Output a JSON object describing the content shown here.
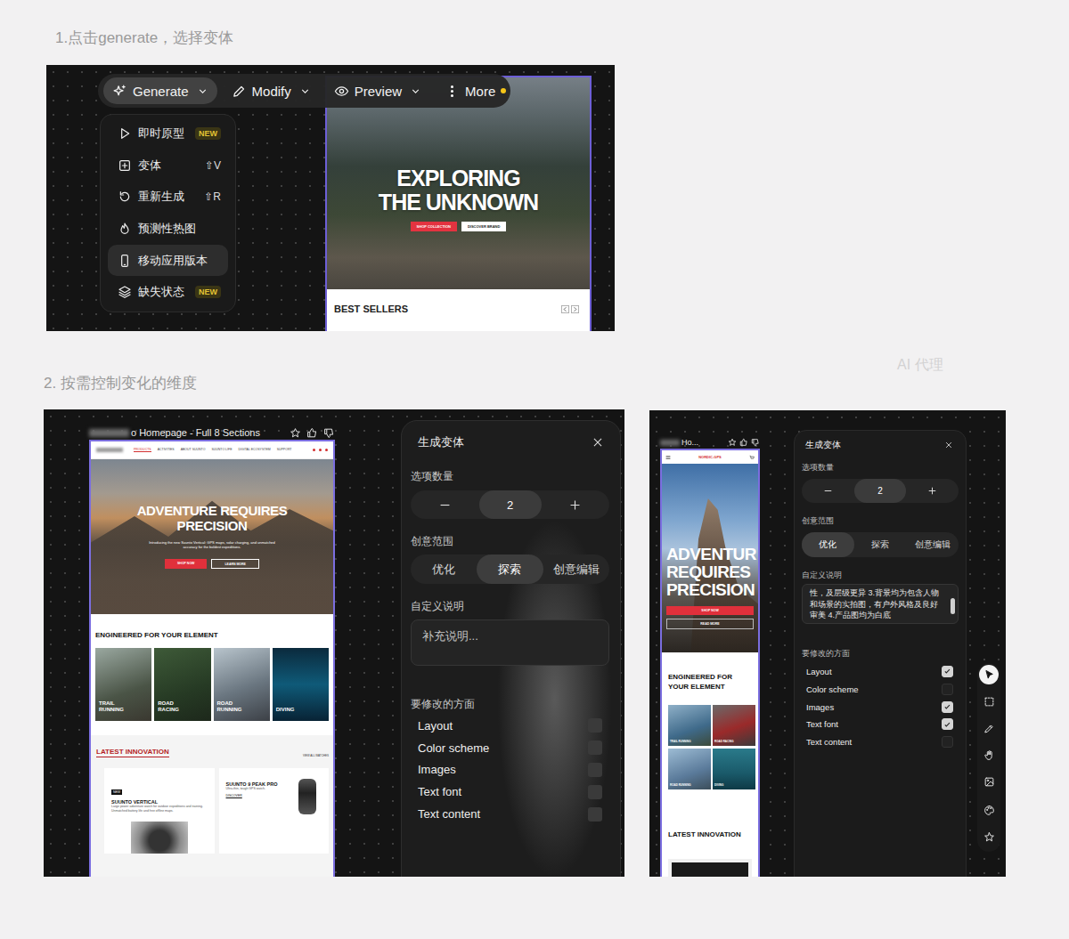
{
  "captions": {
    "step1": "1.点击generate，选择变体",
    "step2": "2. 按需控制变化的维度",
    "agent": "AI 代理"
  },
  "toolbar": [
    {
      "kind": "sparkle",
      "label": "Generate",
      "selected": true,
      "caret": true,
      "dot": false
    },
    {
      "kind": "pencil",
      "label": "Modify",
      "selected": false,
      "caret": true,
      "dot": false
    },
    {
      "kind": "eye",
      "label": "Preview",
      "selected": false,
      "caret": true,
      "dot": false
    },
    {
      "kind": "dots",
      "label": "More",
      "selected": false,
      "caret": false,
      "dot": true
    }
  ],
  "menu": [
    {
      "kind": "play",
      "label": "即时原型",
      "shortcut": "",
      "badge": "NEW",
      "selected": false
    },
    {
      "kind": "plus-square",
      "label": "变体",
      "shortcut": "⇧V",
      "badge": "",
      "selected": false
    },
    {
      "kind": "refresh",
      "label": "重新生成",
      "shortcut": "⇧R",
      "badge": "",
      "selected": false
    },
    {
      "kind": "flame",
      "label": "预测性热图",
      "shortcut": "",
      "badge": "",
      "selected": false
    },
    {
      "kind": "phone",
      "label": "移动应用版本",
      "shortcut": "",
      "badge": "",
      "selected": true
    },
    {
      "kind": "layers",
      "label": "缺失状态",
      "shortcut": "",
      "badge": "NEW",
      "selected": false
    }
  ],
  "site1": {
    "headline": [
      "EXPLORING",
      "THE UNKNOWN"
    ],
    "buttons": [
      {
        "label": "SHOP COLLECTION",
        "primary": true
      },
      {
        "label": "DISCOVER BRAND",
        "primary": false
      }
    ],
    "section": "BEST SELLERS"
  },
  "desktop": {
    "frame_title": "o Homepage - Full 8 Sections",
    "nav": [
      {
        "label": "PRODUCTS",
        "selected": true
      },
      {
        "label": "ACTIVITIES",
        "selected": false
      },
      {
        "label": "ABOUT SUUNTO",
        "selected": false
      },
      {
        "label": "SUUNTO LIFE",
        "selected": false
      },
      {
        "label": "DIGITAL ECOSYSTEM",
        "selected": false
      },
      {
        "label": "SUPPORT",
        "selected": false
      }
    ],
    "headline": [
      "ADVENTURE REQUIRES",
      "PRECISION"
    ],
    "subtitle": "Introducing the new Suunto Vertical: GPS maps, solar charging, and unmatched accuracy for the boldest expeditions.",
    "buttons": [
      {
        "label": "SHOP NOW",
        "primary": true
      },
      {
        "label": "LEARN MORE",
        "primary": false
      }
    ],
    "section": "ENGINEERED FOR YOUR ELEMENT",
    "cards": [
      "TRAIL RUNNING",
      "ROAD RACING",
      "ROAD RUNNING",
      "DIVING"
    ],
    "latest": "LATEST INNOVATION",
    "latest_link": "VIEW ALL WATCHES",
    "products": [
      {
        "badge": "NEW",
        "name": "SUUNTO VERTICAL",
        "text": "Large power adventure watch for outdoor expeditions and training. Unmatched battery life and free offline maps.",
        "link": ""
      },
      {
        "badge": "",
        "name": "SUUNTO 9 PEAK PRO",
        "text": "Ultra-thin, tough GPS watch.",
        "link": "DISCOVER"
      }
    ],
    "dialog": {
      "title": "生成变体",
      "count_label": "选项数量",
      "count": "2",
      "scope_label": "创意范围",
      "scopes": [
        {
          "label": "优化",
          "selected": false
        },
        {
          "label": "探索",
          "selected": true
        },
        {
          "label": "创意编辑",
          "selected": false
        }
      ],
      "notes_label": "自定义说明",
      "notes_text": "补充说明...",
      "notes_is_placeholder": true,
      "aspects_label": "要修改的方面",
      "aspects": [
        {
          "label": "Layout",
          "checked": false
        },
        {
          "label": "Color scheme",
          "checked": false
        },
        {
          "label": "Images",
          "checked": false
        },
        {
          "label": "Text font",
          "checked": false
        },
        {
          "label": "Text content",
          "checked": false
        }
      ]
    }
  },
  "mobile": {
    "frame_title": "Ho...",
    "logo": "NORDIC-GPS",
    "headline": [
      "ADVENTUR",
      "REQUIRES",
      "PRECISION"
    ],
    "buttons": [
      {
        "label": "SHOP NOW",
        "primary": true
      },
      {
        "label": "READ MORE",
        "primary": false
      }
    ],
    "section": "ENGINEERED FOR YOUR ELEMENT",
    "tiles": [
      "TRAIL RUNNING",
      "ROAD RACING",
      "ROAD RUNNING",
      "DIVING"
    ],
    "latest": "LATEST INNOVATION",
    "dialog": {
      "title": "生成变体",
      "count_label": "选项数量",
      "count": "2",
      "scope_label": "创意范围",
      "scopes": [
        {
          "label": "优化",
          "selected": true
        },
        {
          "label": "探索",
          "selected": false
        },
        {
          "label": "创意编辑",
          "selected": false
        }
      ],
      "notes_label": "自定义说明",
      "notes_text": "性，及层级更异 3.背景均为包含人物和场景的实拍图，有户外风格及良好审美 4.产品图均为白底",
      "notes_is_placeholder": false,
      "aspects_label": "要修改的方面",
      "aspects": [
        {
          "label": "Layout",
          "checked": true
        },
        {
          "label": "Color scheme",
          "checked": false
        },
        {
          "label": "Images",
          "checked": true
        },
        {
          "label": "Text font",
          "checked": true
        },
        {
          "label": "Text content",
          "checked": false
        }
      ]
    }
  },
  "tools": [
    [
      {
        "kind": "pointer",
        "selected": true
      },
      {
        "kind": "marquee",
        "selected": false
      },
      {
        "kind": "pen",
        "selected": false
      },
      {
        "kind": "hand",
        "selected": false
      },
      {
        "kind": "image",
        "selected": false
      }
    ],
    [
      {
        "kind": "palette",
        "selected": false
      },
      {
        "kind": "star",
        "selected": false
      }
    ]
  ]
}
